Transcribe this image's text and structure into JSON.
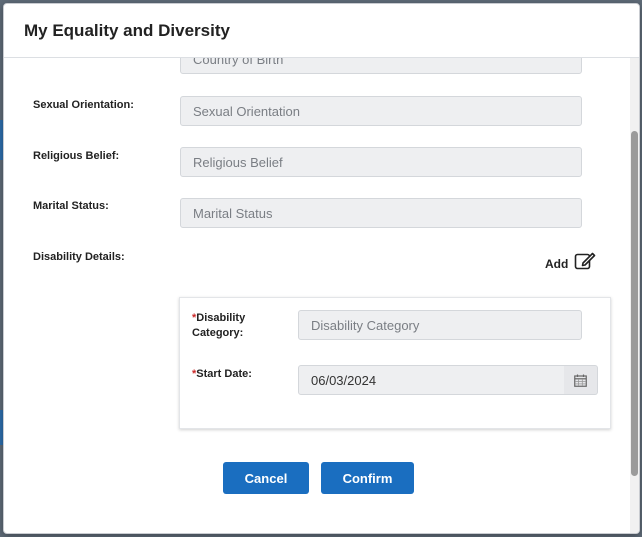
{
  "modal": {
    "title": "My Equality and Diversity"
  },
  "fields": {
    "country_of_birth": {
      "placeholder": "Country of Birth"
    },
    "sexual_orientation": {
      "label": "Sexual Orientation:",
      "placeholder": "Sexual Orientation"
    },
    "religious_belief": {
      "label": "Religious Belief:",
      "placeholder": "Religious Belief"
    },
    "marital_status": {
      "label": "Marital Status:",
      "placeholder": "Marital Status"
    },
    "disability_details": {
      "label": "Disability Details:"
    }
  },
  "disability": {
    "add_label": "Add",
    "required_marker": "*",
    "category_label_line1": "Disability",
    "category_label_line2": "Category:",
    "category_placeholder": "Disability Category",
    "start_date_label": "Start Date:",
    "start_date_value": "06/03/2024"
  },
  "actions": {
    "cancel_label": "Cancel",
    "confirm_label": "Confirm"
  },
  "colors": {
    "primary_button": "#1a6ec0",
    "required_marker": "#cc2a2a",
    "input_background": "#eeeff1"
  },
  "icons": {
    "add": "edit-icon",
    "date_picker": "calendar-icon"
  }
}
